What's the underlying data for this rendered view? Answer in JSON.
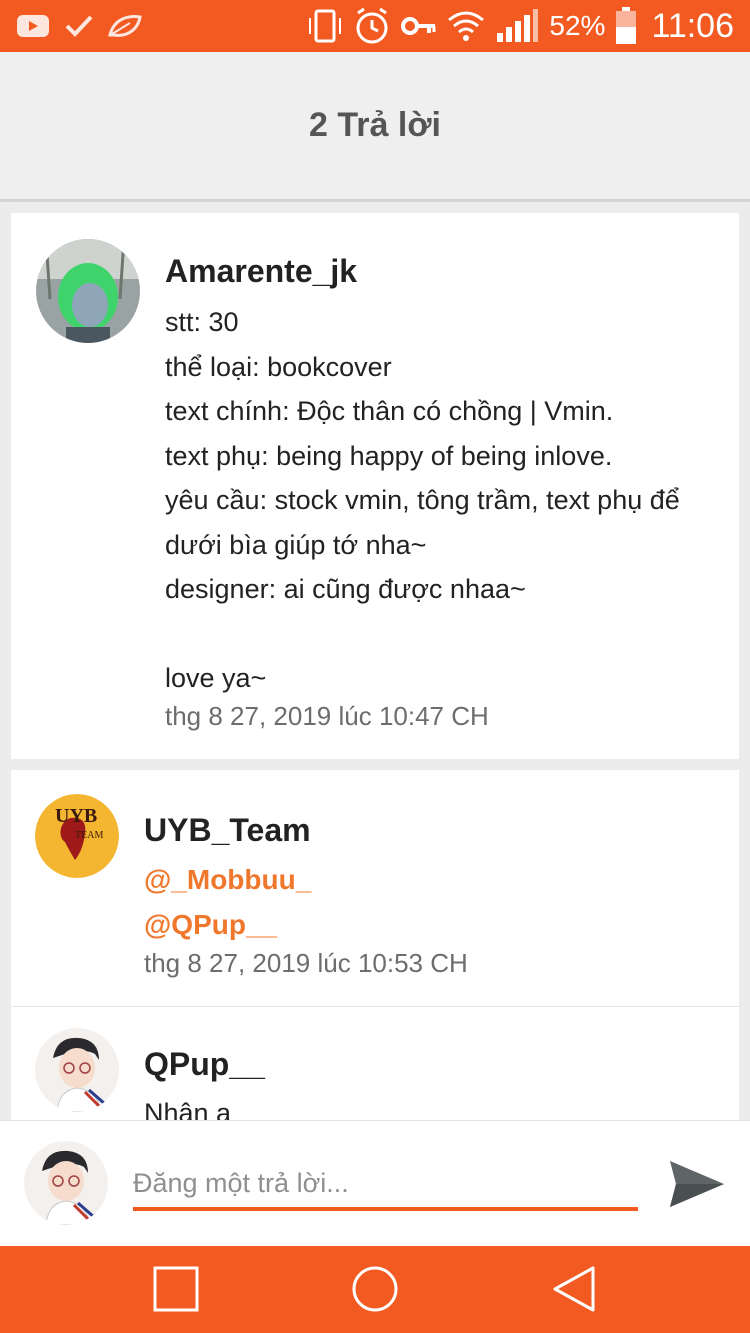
{
  "status_bar": {
    "battery": "52%",
    "time": "11:06"
  },
  "header": {
    "title": "2 Trả lời"
  },
  "comments": [
    {
      "username": "Amarente_jk",
      "body": "stt: 30\nthể loại: bookcover\ntext chính: Độc thân có chồng | Vmin.\ntext phụ: being happy of being inlove.\nyêu cầu: stock vmin, tông trầm, text phụ để\ndưới bìa giúp tớ nha~\ndesigner: ai cũng được nhaa~\n\nlove ya~",
      "timestamp": "thg 8 27, 2019 lúc 10:47 CH"
    },
    {
      "username": "UYB_Team",
      "mentions": [
        "@_Mobbuu_",
        "@QPup__"
      ],
      "timestamp": "thg 8 27, 2019 lúc 10:53 CH",
      "avatar_text": "UYB",
      "avatar_subtext": "TEAM"
    },
    {
      "username": "QPup__",
      "body": "Nhận a"
    }
  ],
  "composer": {
    "placeholder": "Đăng một trả lời..."
  },
  "colors": {
    "accent": "#f25a22",
    "mention": "#f0782c"
  }
}
